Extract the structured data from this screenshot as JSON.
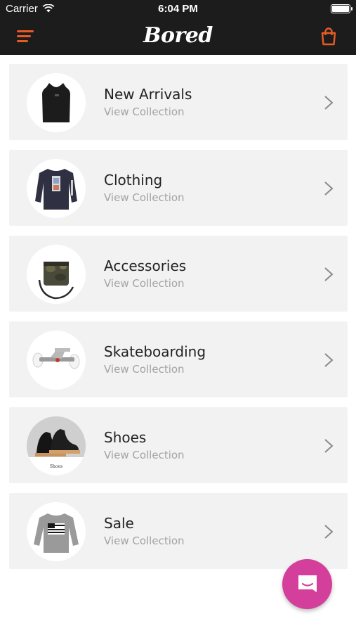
{
  "status_bar": {
    "carrier": "Carrier",
    "time": "6:04 PM",
    "icons": [
      "wifi-icon",
      "battery-icon"
    ]
  },
  "nav": {
    "logo": "Bored",
    "menu_icon": "hamburger-menu-icon",
    "cart_icon": "shopping-bag-icon"
  },
  "collections": [
    {
      "title": "New Arrivals",
      "subtitle": "View Collection",
      "image": "vest-image"
    },
    {
      "title": "Clothing",
      "subtitle": "View Collection",
      "image": "longsleeve-shirt-image"
    },
    {
      "title": "Accessories",
      "subtitle": "View Collection",
      "image": "camo-bag-image"
    },
    {
      "title": "Skateboarding",
      "subtitle": "View Collection",
      "image": "skateboard-truck-image"
    },
    {
      "title": "Shoes",
      "subtitle": "View Collection",
      "image": "shoes-image",
      "image_caption": "Shoes"
    },
    {
      "title": "Sale",
      "subtitle": "View Collection",
      "image": "sweatshirt-image"
    }
  ],
  "chat_button": {
    "icon": "chat-icon"
  },
  "colors": {
    "accent": "#e85a24",
    "topbar_bg": "#1c1c1c",
    "card_bg": "#f2f2f2",
    "subtitle": "#a3a3a3",
    "chat_button": "#d33f9a"
  }
}
